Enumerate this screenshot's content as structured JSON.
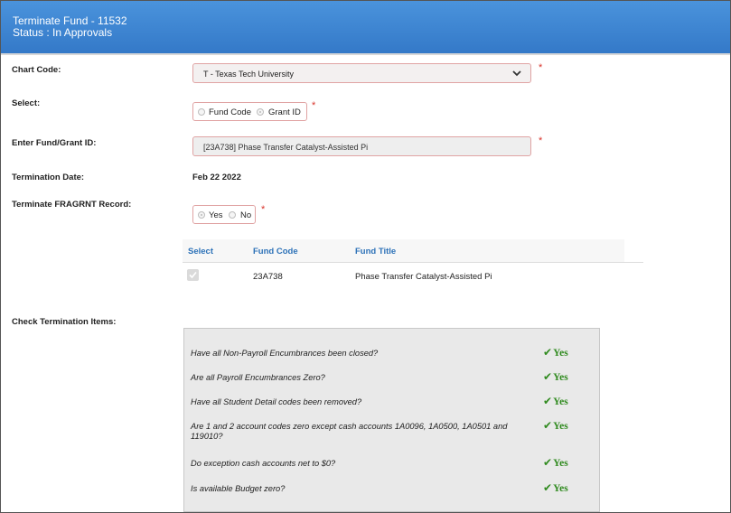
{
  "header": {
    "title_line1": "Terminate Fund - 11532",
    "title_line2": "Status : In Approvals"
  },
  "form": {
    "chart_code": {
      "label": "Chart Code:",
      "value": "T - Texas Tech University",
      "icon": "chevron-down-icon"
    },
    "select": {
      "label": "Select:",
      "options": [
        "Fund Code",
        "Grant ID"
      ],
      "selected": "Grant ID"
    },
    "fund_grant_id": {
      "label": "Enter Fund/Grant ID:",
      "value": "[23A738] Phase Transfer Catalyst-Assisted Pi"
    },
    "termination_date": {
      "label": "Termination Date:",
      "value": "Feb 22 2022"
    },
    "terminate_fragrnt": {
      "label": "Terminate FRAGRNT Record:",
      "options": [
        "Yes",
        "No"
      ],
      "selected": "Yes"
    },
    "required_mark": "*"
  },
  "fund_table": {
    "columns": [
      "Select",
      "Fund Code",
      "Fund Title"
    ],
    "rows": [
      {
        "selected": true,
        "fund_code": "23A738",
        "fund_title": "Phase Transfer Catalyst-Assisted Pi"
      }
    ]
  },
  "checks": {
    "label": "Check Termination Items:",
    "items": [
      {
        "question": "Have all Non-Payroll Encumbrances been closed?",
        "answer": "Yes"
      },
      {
        "question": "Are all Payroll Encumbrances Zero?",
        "answer": "Yes"
      },
      {
        "question": "Have all Student Detail codes been removed?",
        "answer": "Yes"
      },
      {
        "question": "Are 1 and 2 account codes zero except cash accounts 1A0096, 1A0500, 1A0501 and 119010?",
        "answer": "Yes"
      },
      {
        "question": "Do exception cash accounts net to $0?",
        "answer": "Yes"
      },
      {
        "question": "Is available Budget zero?",
        "answer": "Yes"
      }
    ],
    "check_symbol": "✔"
  },
  "colors": {
    "header_bg": "#3a86d4",
    "link_blue": "#2d72b8",
    "yes_green": "#2f8a1e",
    "required_red": "#d9342b"
  }
}
